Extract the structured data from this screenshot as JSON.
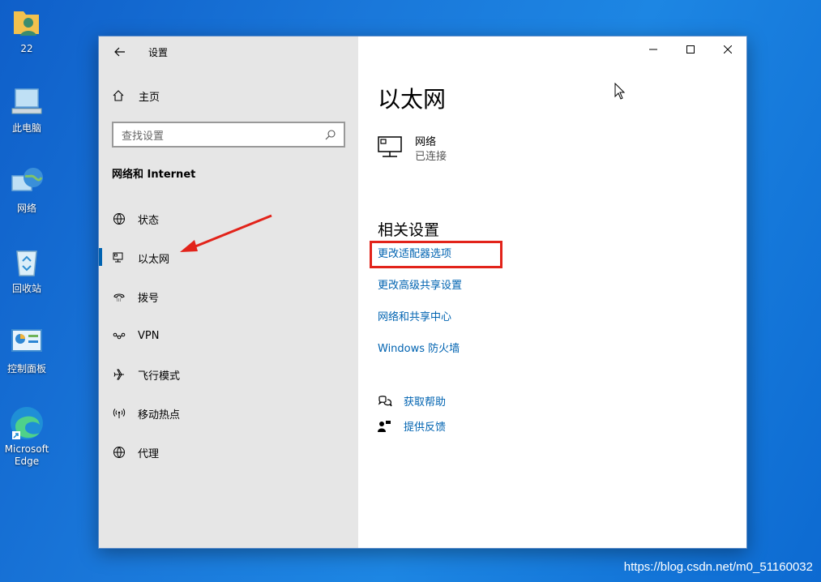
{
  "desktop": {
    "icons": [
      {
        "label": "22"
      },
      {
        "label": "此电脑"
      },
      {
        "label": "网络"
      },
      {
        "label": "回收站"
      },
      {
        "label": "控制面板"
      },
      {
        "label": "Microsoft Edge"
      }
    ]
  },
  "window": {
    "title": "设置",
    "sidebar": {
      "home_label": "主页",
      "search_placeholder": "查找设置",
      "section_title": "网络和 Internet",
      "items": [
        {
          "label": "状态",
          "icon": "globe-status-icon"
        },
        {
          "label": "以太网",
          "icon": "ethernet-icon",
          "active": true
        },
        {
          "label": "拨号",
          "icon": "dialup-icon"
        },
        {
          "label": "VPN",
          "icon": "vpn-icon"
        },
        {
          "label": "飞行模式",
          "icon": "airplane-icon"
        },
        {
          "label": "移动热点",
          "icon": "hotspot-icon"
        },
        {
          "label": "代理",
          "icon": "proxy-globe-icon"
        }
      ]
    },
    "content": {
      "page_title": "以太网",
      "network": {
        "name": "网络",
        "status": "已连接"
      },
      "related_title": "相关设置",
      "links": [
        "更改适配器选项",
        "更改高级共享设置",
        "网络和共享中心",
        "Windows 防火墙"
      ],
      "help": {
        "get_help": "获取帮助",
        "feedback": "提供反馈"
      }
    }
  },
  "watermark": "https://blog.csdn.net/m0_51160032",
  "colors": {
    "accent": "#0063b1",
    "annotation": "#e2231a",
    "sidebar_bg": "#e6e6e6"
  }
}
